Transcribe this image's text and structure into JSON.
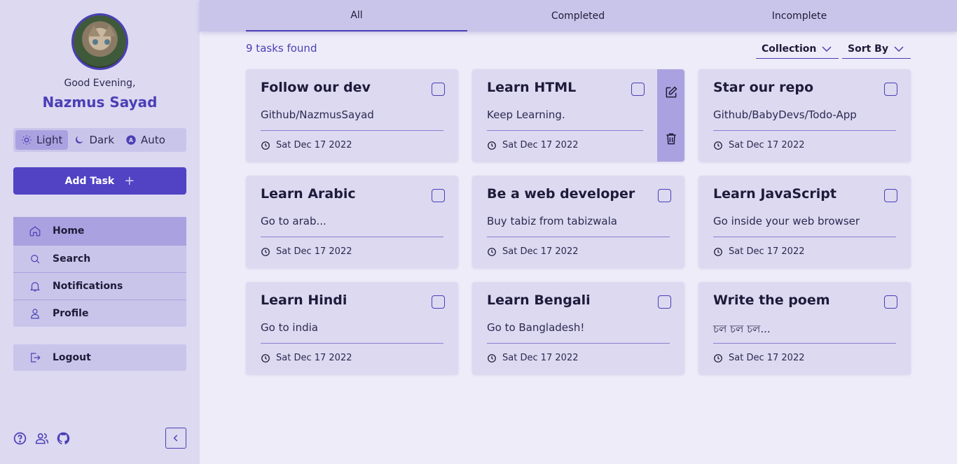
{
  "user": {
    "greeting": "Good Evening,",
    "name": "Nazmus Sayad"
  },
  "theme": {
    "options": [
      "Light",
      "Dark",
      "Auto"
    ],
    "active": "Light"
  },
  "add_task": {
    "label": "Add Task",
    "icon": "plus-icon"
  },
  "nav": [
    {
      "label": "Home",
      "icon": "home-icon",
      "active": true
    },
    {
      "label": "Search",
      "icon": "search-icon"
    },
    {
      "label": "Notifications",
      "icon": "bell-icon"
    },
    {
      "label": "Profile",
      "icon": "user-icon"
    }
  ],
  "logout": {
    "label": "Logout",
    "icon": "logout-icon"
  },
  "footer": {
    "icons": [
      "help-icon",
      "team-icon",
      "github-icon"
    ],
    "collapse_icon": "chevron-left-icon"
  },
  "tabs": [
    {
      "label": "All",
      "active": true
    },
    {
      "label": "Completed"
    },
    {
      "label": "Incomplete"
    }
  ],
  "task_count": "9 tasks found",
  "filters": {
    "collection": "Collection",
    "sort": "Sort By"
  },
  "colors": {
    "accent": "#4b3fb6",
    "sidebar_bg": "#dcd9f1",
    "card_bg": "#dcd9f1",
    "page_bg": "#eeecf8",
    "button": "#5143c4"
  },
  "tasks": [
    {
      "title": "Follow our dev",
      "description": "Github/NazmusSayad",
      "date": "Sat Dec 17 2022"
    },
    {
      "title": "Learn HTML",
      "description": "Keep Learning.",
      "date": "Sat Dec 17 2022",
      "hovered": true
    },
    {
      "title": "Star our repo",
      "description": "Github/BabyDevs/Todo-App",
      "date": "Sat Dec 17 2022"
    },
    {
      "title": "Learn Arabic",
      "description": "Go to arab...",
      "date": "Sat Dec 17 2022"
    },
    {
      "title": "Be a web developer",
      "description": "Buy tabiz from tabizwala",
      "date": "Sat Dec 17 2022"
    },
    {
      "title": "Learn JavaScript",
      "description": "Go inside your web browser",
      "date": "Sat Dec 17 2022"
    },
    {
      "title": "Learn Hindi",
      "description": "Go to india",
      "date": "Sat Dec 17 2022"
    },
    {
      "title": "Learn Bengali",
      "description": "Go to Bangladesh!",
      "date": "Sat Dec 17 2022"
    },
    {
      "title": "Write the poem",
      "description": "চল চল চল...",
      "date": "Sat Dec 17 2022"
    }
  ]
}
